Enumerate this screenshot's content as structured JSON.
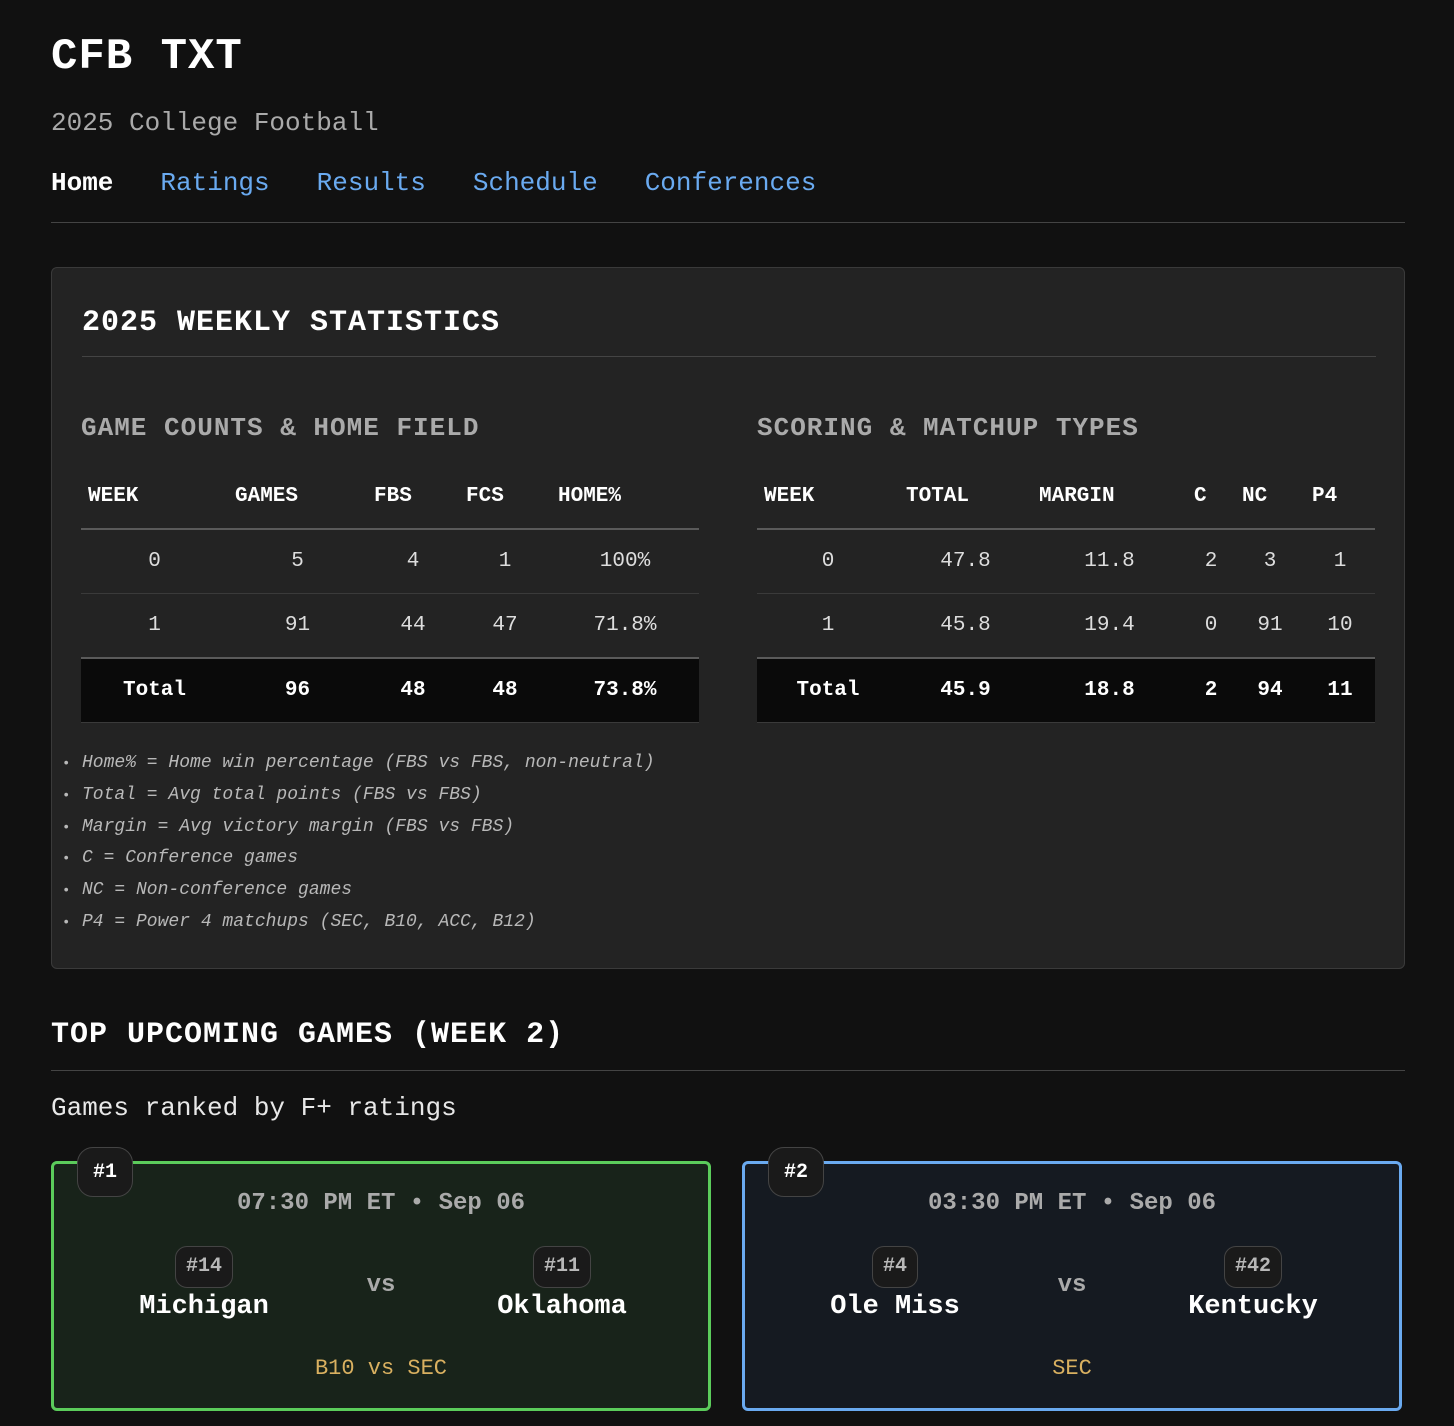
{
  "site": {
    "title": "CFB TXT",
    "subtitle": "2025 College Football"
  },
  "nav": [
    {
      "label": "Home",
      "active": true
    },
    {
      "label": "Ratings",
      "active": false
    },
    {
      "label": "Results",
      "active": false
    },
    {
      "label": "Schedule",
      "active": false
    },
    {
      "label": "Conferences",
      "active": false
    }
  ],
  "weekly_stats": {
    "title": "2025 WEEKLY STATISTICS",
    "game_counts": {
      "title": "GAME COUNTS & HOME FIELD",
      "headers": [
        "WEEK",
        "GAMES",
        "FBS",
        "FCS",
        "HOME%"
      ],
      "rows": [
        [
          "0",
          "5",
          "4",
          "1",
          "100%"
        ],
        [
          "1",
          "91",
          "44",
          "47",
          "71.8%"
        ]
      ],
      "total": [
        "Total",
        "96",
        "48",
        "48",
        "73.8%"
      ]
    },
    "scoring": {
      "title": "SCORING & MATCHUP TYPES",
      "headers": [
        "WEEK",
        "TOTAL",
        "MARGIN",
        "C",
        "NC",
        "P4"
      ],
      "rows": [
        [
          "0",
          "47.8",
          "11.8",
          "2",
          "3",
          "1"
        ],
        [
          "1",
          "45.8",
          "19.4",
          "0",
          "91",
          "10"
        ]
      ],
      "total": [
        "Total",
        "45.9",
        "18.8",
        "2",
        "94",
        "11"
      ]
    },
    "notes": [
      "Home% = Home win percentage (FBS vs FBS, non-neutral)",
      "Total = Avg total points (FBS vs FBS)",
      "Margin = Avg victory margin (FBS vs FBS)",
      "C = Conference games",
      "NC = Non-conference games",
      "P4 = Power 4 matchups (SEC, B10, ACC, B12)"
    ]
  },
  "upcoming": {
    "title": "TOP UPCOMING GAMES (WEEK 2)",
    "subtitle": "Games ranked by F+ ratings",
    "vs_label": "vs",
    "games": [
      {
        "rank": "#1",
        "time": "07:30 PM ET • Sep 06",
        "away": {
          "seed": "#14",
          "name": "Michigan"
        },
        "home": {
          "seed": "#11",
          "name": "Oklahoma"
        },
        "conference": "B10 vs SEC",
        "border_color": "#5bcc5b"
      },
      {
        "rank": "#2",
        "time": "03:30 PM ET • Sep 06",
        "away": {
          "seed": "#4",
          "name": "Ole Miss"
        },
        "home": {
          "seed": "#42",
          "name": "Kentucky"
        },
        "conference": "SEC",
        "border_color": "#6aaaf0"
      }
    ]
  }
}
